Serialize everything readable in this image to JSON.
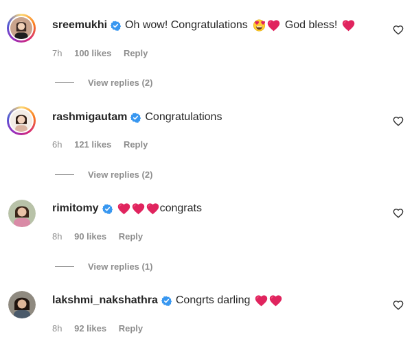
{
  "comments": [
    {
      "username": "sreemukhi",
      "verified": true,
      "text": "Oh wow! Congratulations",
      "text_after": "God bless!",
      "emojis_before": [
        "heart-eyes-emoji",
        "red-heart-emoji"
      ],
      "emoji_after": "red-heart-emoji",
      "time": "7h",
      "likes": "100 likes",
      "reply_label": "Reply",
      "view_replies": "View replies (2)"
    },
    {
      "username": "rashmigautam",
      "verified": true,
      "text": "Congratulations",
      "time": "6h",
      "likes": "121 likes",
      "reply_label": "Reply",
      "view_replies": "View replies (2)"
    },
    {
      "username": "rimitomy",
      "verified": true,
      "emojis": [
        "red-heart-emoji",
        "red-heart-emoji",
        "red-heart-emoji"
      ],
      "text": "congrats",
      "time": "8h",
      "likes": "90 likes",
      "reply_label": "Reply",
      "view_replies": "View replies (1)"
    },
    {
      "username": "lakshmi_nakshathra",
      "verified": true,
      "text": "Congrts darling",
      "emojis": [
        "red-heart-emoji",
        "red-heart-emoji"
      ],
      "time": "8h",
      "likes": "92 likes",
      "reply_label": "Reply"
    }
  ],
  "colors": {
    "verified_blue": "#3897f0",
    "heart_red": "#e0245e",
    "meta_gray": "#8e8e8e"
  },
  "icons": {
    "like": "heart-outline-icon",
    "verified": "verified-badge-icon"
  }
}
